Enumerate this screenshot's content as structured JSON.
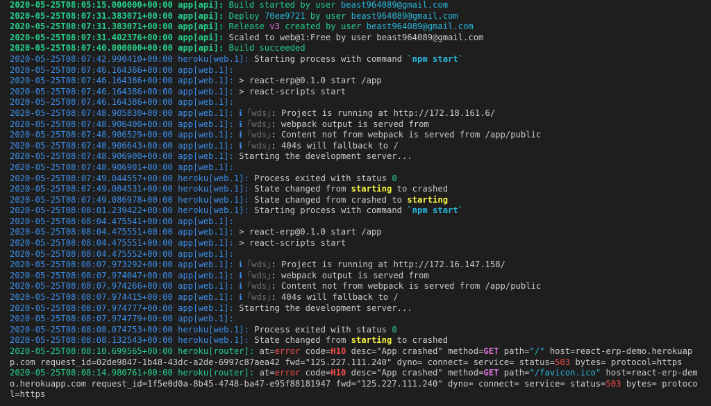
{
  "colors": {
    "background": "#1e1e1e",
    "text": "#cccccc",
    "green": "#23d18b",
    "blue": "#3b8eea",
    "cyan": "#29b8db",
    "yellow": "#f5f543",
    "magenta": "#d670d6",
    "red": "#f14c4c",
    "gray": "#6f6f6f"
  },
  "lines": [
    {
      "s": [
        {
          "t": "2020-05-25T08:05:15.000000+00:00 app[api]: ",
          "c": "ts-green"
        },
        {
          "t": "Build started by user ",
          "c": "c-green"
        },
        {
          "t": "beast964089@gmail.com",
          "c": "c-cyan"
        }
      ]
    },
    {
      "s": [
        {
          "t": "2020-05-25T08:07:31.383071+00:00 app[api]: ",
          "c": "ts-green"
        },
        {
          "t": "Deploy ",
          "c": "c-green"
        },
        {
          "t": "70ee9721",
          "c": "c-cyan"
        },
        {
          "t": " by user ",
          "c": "c-green"
        },
        {
          "t": "beast964089@gmail.com",
          "c": "c-cyan"
        }
      ]
    },
    {
      "s": [
        {
          "t": "2020-05-25T08:07:31.383071+00:00 app[api]: ",
          "c": "ts-green"
        },
        {
          "t": "Release ",
          "c": "c-green"
        },
        {
          "t": "v3",
          "c": "c-magenta"
        },
        {
          "t": " created by user ",
          "c": "c-green"
        },
        {
          "t": "beast964089@gmail.com",
          "c": "c-cyan"
        }
      ]
    },
    {
      "s": [
        {
          "t": "2020-05-25T08:07:31.402376+00:00 app[api]: ",
          "c": "ts-green"
        },
        {
          "t": "Scaled to web@1:Free by user beast964089@gmail.com",
          "c": "c-text"
        }
      ]
    },
    {
      "s": [
        {
          "t": "2020-05-25T08:07:40.000000+00:00 app[api]: ",
          "c": "ts-green"
        },
        {
          "t": "Build succeeded",
          "c": "c-green"
        }
      ]
    },
    {
      "s": [
        {
          "t": "2020-05-25T08:07:42.990410+00:00 heroku[web.1]: ",
          "c": "ts-blue"
        },
        {
          "t": "Starting process with command ",
          "c": "c-text"
        },
        {
          "t": "`npm start`",
          "c": "c-cyan-b"
        }
      ]
    },
    {
      "s": [
        {
          "t": "2020-05-25T08:07:46.164366+00:00 app[web.1]:",
          "c": "ts-blue"
        }
      ]
    },
    {
      "s": [
        {
          "t": "2020-05-25T08:07:46.164386+00:00 app[web.1]: ",
          "c": "ts-blue"
        },
        {
          "t": "> react-erp@0.1.0 start /app",
          "c": "c-text"
        }
      ]
    },
    {
      "s": [
        {
          "t": "2020-05-25T08:07:46.164386+00:00 app[web.1]: ",
          "c": "ts-blue"
        },
        {
          "t": "> react-scripts start",
          "c": "c-text"
        }
      ]
    },
    {
      "s": [
        {
          "t": "2020-05-25T08:07:46.164386+00:00 app[web.1]:",
          "c": "ts-blue"
        }
      ]
    },
    {
      "s": [
        {
          "t": "2020-05-25T08:07:48.905830+00:00 app[web.1]: ",
          "c": "ts-blue"
        },
        {
          "t": "ℹ ",
          "c": "c-info"
        },
        {
          "t": "｢wds｣",
          "c": "c-gray"
        },
        {
          "t": ": Project is running at http://172.18.161.6/",
          "c": "c-text"
        }
      ]
    },
    {
      "s": [
        {
          "t": "2020-05-25T08:07:48.906400+00:00 app[web.1]: ",
          "c": "ts-blue"
        },
        {
          "t": "ℹ ",
          "c": "c-info"
        },
        {
          "t": "｢wds｣",
          "c": "c-gray"
        },
        {
          "t": ": webpack output is served from",
          "c": "c-text"
        }
      ]
    },
    {
      "s": [
        {
          "t": "2020-05-25T08:07:48.906529+00:00 app[web.1]: ",
          "c": "ts-blue"
        },
        {
          "t": "ℹ ",
          "c": "c-info"
        },
        {
          "t": "｢wds｣",
          "c": "c-gray"
        },
        {
          "t": ": Content not from webpack is served from /app/public",
          "c": "c-text"
        }
      ]
    },
    {
      "s": [
        {
          "t": "2020-05-25T08:07:48.906643+00:00 app[web.1]: ",
          "c": "ts-blue"
        },
        {
          "t": "ℹ ",
          "c": "c-info"
        },
        {
          "t": "｢wds｣",
          "c": "c-gray"
        },
        {
          "t": ": 404s will fallback to /",
          "c": "c-text"
        }
      ]
    },
    {
      "s": [
        {
          "t": "2020-05-25T08:07:48.906900+00:00 app[web.1]: ",
          "c": "ts-blue"
        },
        {
          "t": "Starting the development server...",
          "c": "c-text"
        }
      ]
    },
    {
      "s": [
        {
          "t": "2020-05-25T08:07:48.906901+00:00 app[web.1]:",
          "c": "ts-blue"
        }
      ]
    },
    {
      "s": [
        {
          "t": "2020-05-25T08:07:49.044557+00:00 heroku[web.1]: ",
          "c": "ts-blue"
        },
        {
          "t": "Process exited with status ",
          "c": "c-text"
        },
        {
          "t": "0",
          "c": "c-green"
        }
      ]
    },
    {
      "s": [
        {
          "t": "2020-05-25T08:07:49.084531+00:00 heroku[web.1]: ",
          "c": "ts-blue"
        },
        {
          "t": "State changed from ",
          "c": "c-text"
        },
        {
          "t": "starting",
          "c": "c-yellow-b"
        },
        {
          "t": " to crashed",
          "c": "c-text"
        }
      ]
    },
    {
      "s": [
        {
          "t": "2020-05-25T08:07:49.086978+00:00 heroku[web.1]: ",
          "c": "ts-blue"
        },
        {
          "t": "State changed from crashed to ",
          "c": "c-text"
        },
        {
          "t": "starting",
          "c": "c-yellow-b"
        }
      ]
    },
    {
      "s": [
        {
          "t": "2020-05-25T08:08:01.239422+00:00 heroku[web.1]: ",
          "c": "ts-blue"
        },
        {
          "t": "Starting process with command ",
          "c": "c-text"
        },
        {
          "t": "`npm start`",
          "c": "c-cyan-b"
        }
      ]
    },
    {
      "s": [
        {
          "t": "2020-05-25T08:08:04.475541+00:00 app[web.1]:",
          "c": "ts-blue"
        }
      ]
    },
    {
      "s": [
        {
          "t": "2020-05-25T08:08:04.475551+00:00 app[web.1]: ",
          "c": "ts-blue"
        },
        {
          "t": "> react-erp@0.1.0 start /app",
          "c": "c-text"
        }
      ]
    },
    {
      "s": [
        {
          "t": "2020-05-25T08:08:04.475551+00:00 app[web.1]: ",
          "c": "ts-blue"
        },
        {
          "t": "> react-scripts start",
          "c": "c-text"
        }
      ]
    },
    {
      "s": [
        {
          "t": "2020-05-25T08:08:04.475552+00:00 app[web.1]:",
          "c": "ts-blue"
        }
      ]
    },
    {
      "s": [
        {
          "t": "2020-05-25T08:08:07.973292+00:00 app[web.1]: ",
          "c": "ts-blue"
        },
        {
          "t": "ℹ ",
          "c": "c-info"
        },
        {
          "t": "｢wds｣",
          "c": "c-gray"
        },
        {
          "t": ": Project is running at http://172.16.147.158/",
          "c": "c-text"
        }
      ]
    },
    {
      "s": [
        {
          "t": "2020-05-25T08:08:07.974047+00:00 app[web.1]: ",
          "c": "ts-blue"
        },
        {
          "t": "ℹ ",
          "c": "c-info"
        },
        {
          "t": "｢wds｣",
          "c": "c-gray"
        },
        {
          "t": ": webpack output is served from",
          "c": "c-text"
        }
      ]
    },
    {
      "s": [
        {
          "t": "2020-05-25T08:08:07.974266+00:00 app[web.1]: ",
          "c": "ts-blue"
        },
        {
          "t": "ℹ ",
          "c": "c-info"
        },
        {
          "t": "｢wds｣",
          "c": "c-gray"
        },
        {
          "t": ": Content not from webpack is served from /app/public",
          "c": "c-text"
        }
      ]
    },
    {
      "s": [
        {
          "t": "2020-05-25T08:08:07.974415+00:00 app[web.1]: ",
          "c": "ts-blue"
        },
        {
          "t": "ℹ ",
          "c": "c-info"
        },
        {
          "t": "｢wds｣",
          "c": "c-gray"
        },
        {
          "t": ": 404s will fallback to /",
          "c": "c-text"
        }
      ]
    },
    {
      "s": [
        {
          "t": "2020-05-25T08:08:07.974777+00:00 app[web.1]: ",
          "c": "ts-blue"
        },
        {
          "t": "Starting the development server...",
          "c": "c-text"
        }
      ]
    },
    {
      "s": [
        {
          "t": "2020-05-25T08:08:07.974779+00:00 app[web.1]:",
          "c": "ts-blue"
        }
      ]
    },
    {
      "s": [
        {
          "t": "2020-05-25T08:08:08.074753+00:00 heroku[web.1]: ",
          "c": "ts-blue"
        },
        {
          "t": "Process exited with status ",
          "c": "c-text"
        },
        {
          "t": "0",
          "c": "c-green"
        }
      ]
    },
    {
      "s": [
        {
          "t": "2020-05-25T08:08:08.132543+00:00 heroku[web.1]: ",
          "c": "ts-blue"
        },
        {
          "t": "State changed from ",
          "c": "c-text"
        },
        {
          "t": "starting",
          "c": "c-yellow-b"
        },
        {
          "t": " to crashed",
          "c": "c-text"
        }
      ]
    },
    {
      "wrap": true,
      "s": [
        {
          "t": "2020-05-25T08:08:10.699565+00:00 heroku[router]: ",
          "c": "c-green"
        },
        {
          "t": "at=",
          "c": "c-text"
        },
        {
          "t": "error",
          "c": "c-red"
        },
        {
          "t": " code=",
          "c": "c-text"
        },
        {
          "t": "H10",
          "c": "c-red-b"
        },
        {
          "t": " desc=\"App crashed\" method=",
          "c": "c-text"
        },
        {
          "t": "GET",
          "c": "c-magenta-b"
        },
        {
          "t": " path=",
          "c": "c-text"
        },
        {
          "t": "\"/\"",
          "c": "c-cyan"
        },
        {
          "t": " host=react-erp-demo.herokuapp.com request_id=02de9847-1b48-43dc-a2de-6997c87aea42 fwd=\"125.227.111.240\" dyno= connect= service= status=",
          "c": "c-text"
        },
        {
          "t": "503",
          "c": "c-red"
        },
        {
          "t": " bytes= protocol=https",
          "c": "c-text"
        }
      ]
    },
    {
      "wrap": true,
      "s": [
        {
          "t": "2020-05-25T08:08:14.980761+00:00 heroku[router]: ",
          "c": "c-green"
        },
        {
          "t": "at=",
          "c": "c-text"
        },
        {
          "t": "error",
          "c": "c-red"
        },
        {
          "t": " code=",
          "c": "c-text"
        },
        {
          "t": "H10",
          "c": "c-red-b"
        },
        {
          "t": " desc=\"App crashed\" method=",
          "c": "c-text"
        },
        {
          "t": "GET",
          "c": "c-magenta-b"
        },
        {
          "t": " path=",
          "c": "c-text"
        },
        {
          "t": "\"/favicon.ico\"",
          "c": "c-cyan"
        },
        {
          "t": " host=react-erp-demo.herokuapp.com request_id=1f5e0d0a-8b45-4748-ba47-e95f88181947 fwd=\"125.227.111.240\" dyno= connect= service= status=",
          "c": "c-text"
        },
        {
          "t": "503",
          "c": "c-red"
        },
        {
          "t": " bytes= protocol=https",
          "c": "c-text"
        }
      ]
    }
  ]
}
